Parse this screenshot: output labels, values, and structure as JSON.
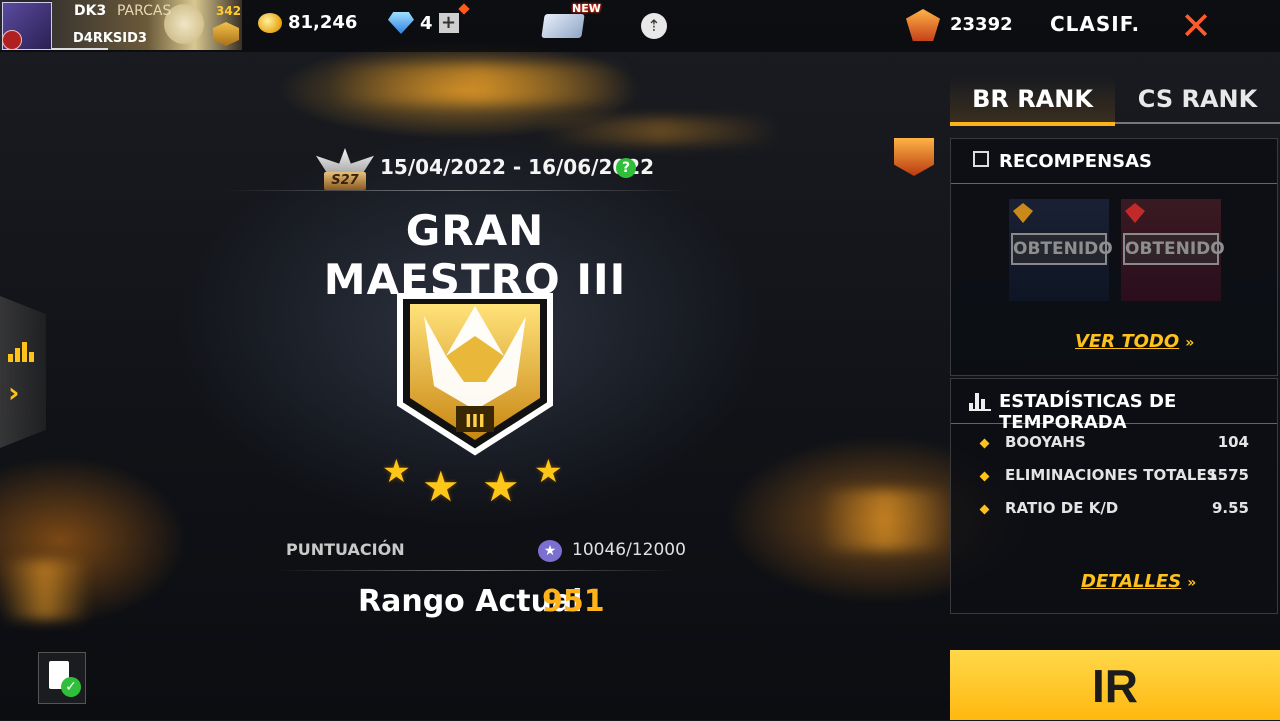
{
  "player": {
    "name_top": "DK3",
    "name_top_tag": "PARCAS",
    "nickname": "D4RKSID3",
    "level": "342"
  },
  "topbar": {
    "coins": "81,246",
    "diamonds": "4",
    "new_label": "NEW",
    "rank_score": "23392",
    "clasif_label": "CLASIF.",
    "close_glyph": "✕"
  },
  "season": {
    "badge": "S27",
    "dates": "15/04/2022 - 16/06/2022",
    "help": "?"
  },
  "rank": {
    "title": "GRAN MAESTRO III",
    "emblem_numeral": "III",
    "stars": 4,
    "score_label": "PUNTUACIÓN",
    "score_progress": "10046/12000",
    "current_rank_label": "Rango Actual",
    "current_rank_value": "951"
  },
  "tabs": [
    {
      "label": "BR RANK",
      "active": true
    },
    {
      "label": "CS RANK",
      "active": false
    }
  ],
  "rewards_panel": {
    "title": "RECOMPENSAS",
    "items": [
      {
        "status": "OBTENIDO"
      },
      {
        "status": "OBTENIDO"
      }
    ],
    "view_all": "VER TODO"
  },
  "stats_panel": {
    "title": "ESTADÍSTICAS DE TEMPORADA",
    "rows": [
      {
        "label": "BOOYAHS",
        "value": "104"
      },
      {
        "label": "ELIMINACIONES TOTALES",
        "value": "1575"
      },
      {
        "label": "RATIO DE K/D",
        "value": "9.55"
      }
    ],
    "details": "DETALLES"
  },
  "go_button": "IR",
  "icons": {
    "coin": "coin-icon",
    "diamond": "diamond-icon",
    "add": "plus-icon",
    "card": "membership-card-icon",
    "cloud": "cloud-upload-icon",
    "rank_score": "rank-token-icon",
    "close": "close-icon",
    "chart": "bar-chart-icon",
    "chevron": "chevron-right-icon",
    "gift": "gift-icon",
    "stats": "stats-icon",
    "report": "report-icon"
  },
  "colors": {
    "accent": "#ffb21a",
    "close": "#ff5a2a",
    "help": "#2fbf3a",
    "score_star": "#7b6fd0"
  }
}
